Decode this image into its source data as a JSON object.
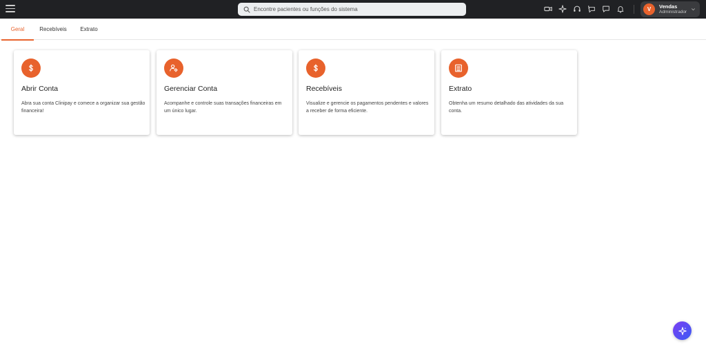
{
  "topbar": {
    "search": {
      "placeholder": "Encontre pacientes ou funções do sistema",
      "value": ""
    },
    "icons": [
      "video-camera-icon",
      "sparkle-icon",
      "headset-icon",
      "chat-alert-icon",
      "message-icon",
      "bell-icon"
    ],
    "user": {
      "initial": "V",
      "name": "Vendas",
      "role": "Administrador"
    }
  },
  "tabs": [
    {
      "label": "Geral",
      "active": true
    },
    {
      "label": "Recebíveis",
      "active": false
    },
    {
      "label": "Extrato",
      "active": false
    }
  ],
  "cards": [
    {
      "icon": "dollar-icon",
      "title": "Abrir Conta",
      "description": "Abra sua conta Clinipay e comece a organizar sua gestão financeira!"
    },
    {
      "icon": "user-settings-icon",
      "title": "Gerenciar Conta",
      "description": "Acompanhe e controle suas transações financeiras em um único lugar."
    },
    {
      "icon": "dollar-icon",
      "title": "Recebíveis",
      "description": "Visualize e gerencie os pagamentos pendentes e valores a receber de forma eficiente."
    },
    {
      "icon": "document-list-icon",
      "title": "Extrato",
      "description": "Obtenha um resumo detalhado das atividades da sua conta."
    }
  ],
  "fab": {
    "icon": "sparkle-assistant-icon"
  },
  "colors": {
    "accent": "#e8622c",
    "topbar": "#202124",
    "fab_start": "#7b3ff2",
    "fab_end": "#3b5bf5"
  }
}
